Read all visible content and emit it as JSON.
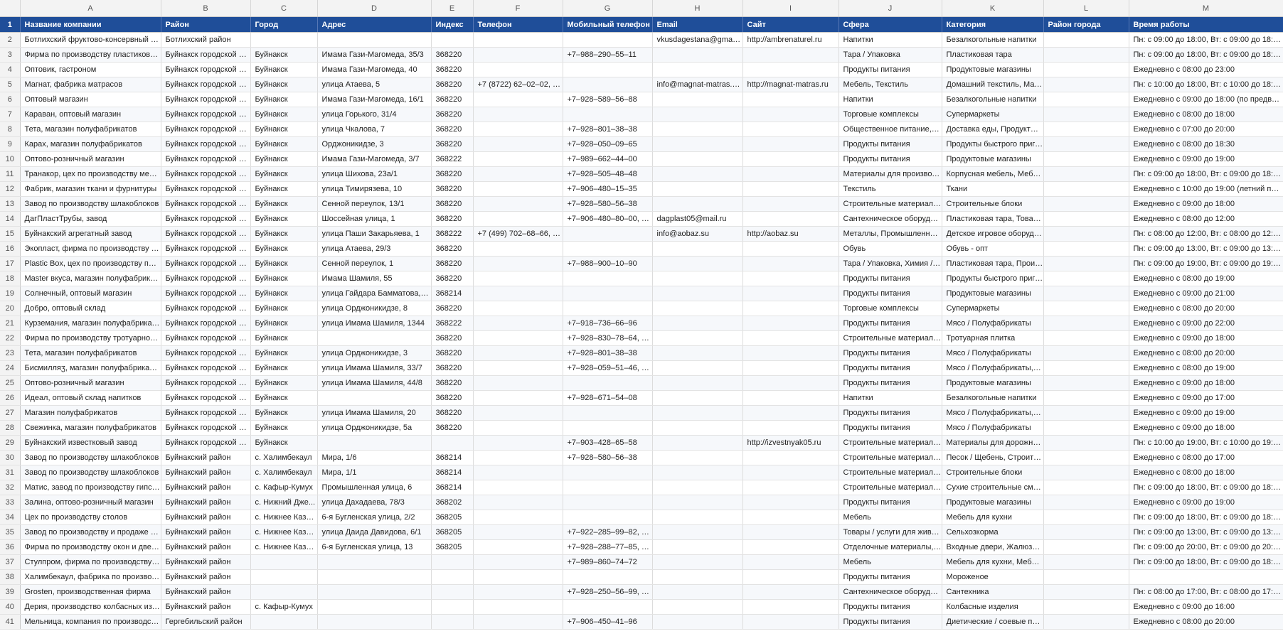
{
  "columns": [
    "A",
    "B",
    "C",
    "D",
    "E",
    "F",
    "G",
    "H",
    "I",
    "J",
    "K",
    "L",
    "M"
  ],
  "header_row_number": "1",
  "headers": [
    "Название компании",
    "Район",
    "Город",
    "Адрес",
    "Индекс",
    "Телефон",
    "Мобильный телефон",
    "Email",
    "Сайт",
    "Сфера",
    "Категория",
    "Район города",
    "Время работы"
  ],
  "rows": [
    {
      "n": "2",
      "cells": [
        "Ботлихский фруктово-консервный за...",
        "Ботлихский район",
        "",
        "",
        "",
        "",
        "",
        "vkusdagestana@gmail.c...",
        "http://ambrenaturel.ru",
        "Напитки",
        "Безалкогольные напитки",
        "",
        "Пн: с 09:00 до 18:00, Вт: с 09:00 до 18:00, С..."
      ]
    },
    {
      "n": "3",
      "cells": [
        "Фирма по производству пластиковых...",
        "Буйнакск городской ок...",
        "Буйнакск",
        "Имама Гази-Магомеда, 35/3",
        "368220",
        "",
        "+7‒988‒290‒55‒11",
        "",
        "",
        "Тара / Упаковка",
        "Пластиковая тара",
        "",
        "Пн: с 09:00 до 18:00, Вт: с 09:00 до 18:00, С..."
      ]
    },
    {
      "n": "4",
      "cells": [
        "Оптовик, гастроном",
        "Буйнакск городской ок...",
        "Буйнакск",
        "Имама Гази-Магомеда, 40",
        "368220",
        "",
        "",
        "",
        "",
        "Продукты питания",
        "Продуктовые магазины",
        "",
        "Ежедневно с 08:00 до 23:00"
      ]
    },
    {
      "n": "5",
      "cells": [
        "Магнат, фабрика матрасов",
        "Буйнакск городской ок...",
        "Буйнакск",
        "улица Атаева, 5",
        "368220",
        "+7 (8722) 62‒02‒02, 8‒...",
        "",
        "info@magnat-matras.ru...",
        "http://magnat-matras.ru",
        "Мебель, Текстиль",
        "Домашний текстиль, Матр...",
        "",
        "Пн: с 10:00 до 18:00, Вт: с 10:00 до 18:00, С..."
      ]
    },
    {
      "n": "6",
      "cells": [
        "Оптовый магазин",
        "Буйнакск городской ок...",
        "Буйнакск",
        "Имама Гази-Магомеда, 16/1",
        "368220",
        "",
        "+7‒928‒589‒56‒88",
        "",
        "",
        "Напитки",
        "Безалкогольные напитки",
        "",
        "Ежедневно с 09:00 до 18:00 (по предвари..."
      ]
    },
    {
      "n": "7",
      "cells": [
        "Караван, оптовый магазин",
        "Буйнакск городской ок...",
        "Буйнакск",
        "улица Горького, 31/4",
        "368220",
        "",
        "",
        "",
        "",
        "Торговые комплексы",
        "Супермаркеты",
        "",
        "Ежедневно с 08:00 до 18:00"
      ]
    },
    {
      "n": "8",
      "cells": [
        "Тета, магазин полуфабрикатов",
        "Буйнакск городской ок...",
        "Буйнакск",
        "улица Чкалова, 7",
        "368220",
        "",
        "+7‒928‒801‒38‒38",
        "",
        "",
        "Общественное питание, П...",
        "Доставка еды, Продукты б...",
        "",
        "Ежедневно с 07:00 до 20:00"
      ]
    },
    {
      "n": "9",
      "cells": [
        "Карах, магазин полуфабрикатов",
        "Буйнакск городской ок...",
        "Буйнакск",
        "Орджоникидзе, 3",
        "368220",
        "",
        "+7‒928‒050‒09‒65",
        "",
        "",
        "Продукты питания",
        "Продукты быстрого приго...",
        "",
        "Ежедневно с 08:00 до 18:30"
      ]
    },
    {
      "n": "10",
      "cells": [
        "Оптово-розничный магазин",
        "Буйнакск городской ок...",
        "Буйнакск",
        "Имама Гази-Магомеда, 3/7",
        "368222",
        "",
        "+7‒989‒662‒44‒00",
        "",
        "",
        "Продукты питания",
        "Продуктовые магазины",
        "",
        "Ежедневно с 09:00 до 19:00"
      ]
    },
    {
      "n": "11",
      "cells": [
        "Транакор, цех по производству мебели",
        "Буйнакск городской ок...",
        "Буйнакск",
        "улица Шихова, 23а/1",
        "368220",
        "",
        "+7‒928‒505‒48‒48",
        "",
        "",
        "Материалы для производс...",
        "Корпусная мебель, Мебел...",
        "",
        "Пн: с 09:00 до 18:00, Вт: с 09:00 до 18:00, С..."
      ]
    },
    {
      "n": "12",
      "cells": [
        "Фабрик, магазин ткани и фурнитуры",
        "Буйнакск городской ок...",
        "Буйнакск",
        "улица Тимирязева, 10",
        "368220",
        "",
        "+7‒906‒480‒15‒35",
        "",
        "",
        "Текстиль",
        "Ткани",
        "",
        "Ежедневно с 10:00 до 19:00 (летний пери..."
      ]
    },
    {
      "n": "13",
      "cells": [
        "Завод по производству шлакоблоков",
        "Буйнакск городской ок...",
        "Буйнакск",
        "Сенной переулок, 13/1",
        "368220",
        "",
        "+7‒928‒580‒56‒38",
        "",
        "",
        "Строительные материалы ...",
        "Строительные блоки",
        "",
        "Ежедневно с 09:00 до 18:00"
      ]
    },
    {
      "n": "14",
      "cells": [
        "ДагПластТрубы, завод",
        "Буйнакск городской ок...",
        "Буйнакск",
        "Шоссейная улица, 1",
        "368220",
        "",
        "+7‒906‒480‒80‒00, +7...",
        "dagplast05@mail.ru",
        "",
        "Сантехническое оборудов...",
        "Пластиковая тара, Товары ...",
        "",
        "Ежедневно с 08:00 до 12:00"
      ]
    },
    {
      "n": "15",
      "cells": [
        "Буйнакский агрегатный завод",
        "Буйнакск городской ок...",
        "Буйнакск",
        "улица Паши Закарьяева, 1",
        "368222",
        "+7 (499) 702‒68‒66, +7...",
        "",
        "info@aobaz.su",
        "http://aobaz.su",
        "Металлы, Промышленное ...",
        "Детское игровое оборудо...",
        "",
        "Пн: с 08:00 до 12:00, Вт: с 08:00 до 12:00, С..."
      ]
    },
    {
      "n": "16",
      "cells": [
        "Экопласт, фирма по производству по...",
        "Буйнакск городской ок...",
        "Буйнакск",
        "улица Атаева, 29/3",
        "368220",
        "",
        "",
        "",
        "",
        "Обувь",
        "Обувь - опт",
        "",
        "Пн: с 09:00 до 13:00, Вт: с 09:00 до 13:00, С..."
      ]
    },
    {
      "n": "17",
      "cells": [
        "Plastic Box, цех по производству плас...",
        "Буйнакск городской ок...",
        "Буйнакск",
        "Сенной переулок, 1",
        "368220",
        "",
        "+7‒988‒900‒10‒90",
        "",
        "",
        "Тара / Упаковка, Химия / В...",
        "Пластиковая тара, Произв...",
        "",
        "Пн: с 09:00 до 19:00, Вт: с 09:00 до 19:00, С..."
      ]
    },
    {
      "n": "18",
      "cells": [
        "Master вкуса, магазин полуфабрикатов",
        "Буйнакск городской ок...",
        "Буйнакск",
        "Имама Шамиля, 55",
        "368220",
        "",
        "",
        "",
        "",
        "Продукты питания",
        "Продукты быстрого приго...",
        "",
        "Ежедневно с 08:00 до 19:00"
      ]
    },
    {
      "n": "19",
      "cells": [
        "Солнечный, оптовый магазин",
        "Буйнакск городской ок...",
        "Буйнакск",
        "улица Гайдара Бамматова, 1/2",
        "368214",
        "",
        "",
        "",
        "",
        "Продукты питания",
        "Продуктовые магазины",
        "",
        "Ежедневно с 09:00 до 21:00"
      ]
    },
    {
      "n": "20",
      "cells": [
        "Добро, оптовый склад",
        "Буйнакск городской ок...",
        "Буйнакск",
        "улица Орджоникидзе, 8",
        "368220",
        "",
        "",
        "",
        "",
        "Торговые комплексы",
        "Супермаркеты",
        "",
        "Ежедневно с 08:00 до 20:00"
      ]
    },
    {
      "n": "21",
      "cells": [
        "Курземания, магазин полуфабрикатов",
        "Буйнакск городской ок...",
        "Буйнакск",
        "улица Имама Шамиля, 1344",
        "368222",
        "",
        "+7‒918‒736‒66‒96",
        "",
        "",
        "Продукты питания",
        "Мясо / Полуфабрикаты",
        "",
        "Ежедневно с 09:00 до 22:00"
      ]
    },
    {
      "n": "22",
      "cells": [
        "Фирма по производству тротуарной ...",
        "Буйнакск городской ок...",
        "Буйнакск",
        "",
        "368220",
        "",
        "+7‒928‒830‒78‒64, +7...",
        "",
        "",
        "Строительные материалы ...",
        "Тротуарная плитка",
        "",
        "Ежедневно с 09:00 до 18:00"
      ]
    },
    {
      "n": "23",
      "cells": [
        "Тета, магазин полуфабрикатов",
        "Буйнакск городской ок...",
        "Буйнакск",
        "улица Орджоникидзе, 3",
        "368220",
        "",
        "+7‒928‒801‒38‒38",
        "",
        "",
        "Продукты питания",
        "Мясо / Полуфабрикаты",
        "",
        "Ежедневно с 08:00 до 20:00"
      ]
    },
    {
      "n": "24",
      "cells": [
        "Бисмилляӡ, магазин полуфабрикатов",
        "Буйнакск городской ок...",
        "Буйнакск",
        "улица Имама Шамиля, 33/7",
        "368220",
        "",
        "+7‒928‒059‒51‒46, +7...",
        "",
        "",
        "Продукты питания",
        "Мясо / Полуфабрикаты, П...",
        "",
        "Ежедневно с 08:00 до 19:00"
      ]
    },
    {
      "n": "25",
      "cells": [
        "Оптово-розничный магазин",
        "Буйнакск городской ок...",
        "Буйнакск",
        "улица Имама Шамиля, 44/8",
        "368220",
        "",
        "",
        "",
        "",
        "Продукты питания",
        "Продуктовые магазины",
        "",
        "Ежедневно с 09:00 до 18:00"
      ]
    },
    {
      "n": "26",
      "cells": [
        "Идеал, оптовый склад напитков",
        "Буйнакск городской ок...",
        "Буйнакск",
        "",
        "368220",
        "",
        "+7‒928‒671‒54‒08",
        "",
        "",
        "Напитки",
        "Безалкогольные напитки",
        "",
        "Ежедневно с 09:00 до 17:00"
      ]
    },
    {
      "n": "27",
      "cells": [
        "Магазин полуфабрикатов",
        "Буйнакск городской ок...",
        "Буйнакск",
        "улица Имама Шамиля, 20",
        "368220",
        "",
        "",
        "",
        "",
        "Продукты питания",
        "Мясо / Полуфабрикаты, М...",
        "",
        "Ежедневно с 09:00 до 19:00"
      ]
    },
    {
      "n": "28",
      "cells": [
        "Свежинка, магазин полуфабрикатов",
        "Буйнакск городской ок...",
        "Буйнакск",
        "улица Орджоникидзе, 5а",
        "368220",
        "",
        "",
        "",
        "",
        "Продукты питания",
        "Мясо / Полуфабрикаты",
        "",
        "Ежедневно с 09:00 до 18:00"
      ]
    },
    {
      "n": "29",
      "cells": [
        "Буйнакский известковый завод",
        "Буйнакск городской ок...",
        "Буйнакск",
        "",
        "",
        "",
        "+7‒903‒428‒65‒58",
        "",
        "http://izvestnyak05.ru",
        "Строительные материалы ...",
        "Материалы для дорожног...",
        "",
        "Пн: с 10:00 до 19:00, Вт: с 10:00 до 19:00, С..."
      ]
    },
    {
      "n": "30",
      "cells": [
        "Завод по производству шлакоблоков",
        "Буйнакский район",
        "с. Халимбекаул",
        "Мира, 1/6",
        "368214",
        "",
        "+7‒928‒580‒56‒38",
        "",
        "",
        "Строительные материалы ...",
        "Песок / Щебень, Строител...",
        "",
        "Ежедневно с 08:00 до 17:00"
      ]
    },
    {
      "n": "31",
      "cells": [
        "Завод по производству шлакоблоков",
        "Буйнакский район",
        "с. Халимбекаул",
        "Мира, 1/1",
        "368214",
        "",
        "",
        "",
        "",
        "Строительные материалы ...",
        "Строительные блоки",
        "",
        "Ежедневно с 08:00 до 18:00"
      ]
    },
    {
      "n": "32",
      "cells": [
        "Матис, завод по производству гипсов...",
        "Буйнакский район",
        "с. Кафыр-Кумух",
        "Промышленная улица, 6",
        "368214",
        "",
        "",
        "",
        "",
        "Строительные материалы ...",
        "Сухие строительные смеси",
        "",
        "Пн: с 09:00 до 18:00, Вт: с 09:00 до 18:00, С..."
      ]
    },
    {
      "n": "33",
      "cells": [
        "Залина, оптово-розничный магазин",
        "Буйнакский район",
        "с. Нижний Дже...",
        "улица Дахадаева, 78/3",
        "368202",
        "",
        "",
        "",
        "",
        "Продукты питания",
        "Продуктовые магазины",
        "",
        "Ежедневно с 09:00 до 19:00"
      ]
    },
    {
      "n": "34",
      "cells": [
        "Цех по производству столов",
        "Буйнакский район",
        "с. Нижнее Каза...",
        "6-я Бугленская улица, 2/2",
        "368205",
        "",
        "",
        "",
        "",
        "Мебель",
        "Мебель для кухни",
        "",
        "Пн: с 09:00 до 18:00, Вт: с 09:00 до 18:00, С..."
      ]
    },
    {
      "n": "35",
      "cells": [
        "Завод по производству и продаже се...",
        "Буйнакский район",
        "с. Нижнее Каза...",
        "улица Даида Давидова, 6/1",
        "368205",
        "",
        "+7‒922‒285‒99‒82, +7...",
        "",
        "",
        "Товары / услуги для живот...",
        "Сельхозкорма",
        "",
        "Пн: с 09:00 до 13:00, Вт: с 09:00 до 13:00, С..."
      ]
    },
    {
      "n": "36",
      "cells": [
        "Фирма по производству окон и дверей",
        "Буйнакский район",
        "с. Нижнее Каза...",
        "6-я Бугленская улица, 13",
        "368205",
        "",
        "+7‒928‒288‒77‒85, +7...",
        "",
        "",
        "Отделочные материалы, П...",
        "Входные двери, Жалюзи, ...",
        "",
        "Пн: с 09:00 до 20:00, Вт: с 09:00 до 20:00, С..."
      ]
    },
    {
      "n": "37",
      "cells": [
        "Стулпром, фирма по производству ст...",
        "Буйнакский район",
        "",
        "",
        "",
        "",
        "+7‒989‒860‒74‒72",
        "",
        "",
        "Мебель",
        "Мебель для кухни, Мебель...",
        "",
        "Пн: с 09:00 до 18:00, Вт: с 09:00 до 18:00, С..."
      ]
    },
    {
      "n": "38",
      "cells": [
        "Халимбекаул, фабрика по производст...",
        "Буйнакский район",
        "",
        "",
        "",
        "",
        "",
        "",
        "",
        "Продукты питания",
        "Мороженое",
        "",
        ""
      ]
    },
    {
      "n": "39",
      "cells": [
        "Grosten, производственная фирма",
        "Буйнакский район",
        "",
        "",
        "",
        "",
        "+7‒928‒250‒56‒99, +7...",
        "",
        "",
        "Сантехническое оборудов...",
        "Сантехника",
        "",
        "Пн: с 08:00 до 17:00, Вт: с 08:00 до 17:00, С..."
      ]
    },
    {
      "n": "40",
      "cells": [
        "Дерия, производство колбасных изде...",
        "Буйнакский район",
        "с. Кафыр-Кумух",
        "",
        "",
        "",
        "",
        "",
        "",
        "Продукты питания",
        "Колбасные изделия",
        "",
        "Ежедневно с 09:00 до 16:00"
      ]
    },
    {
      "n": "41",
      "cells": [
        "Мельница, компания по производств...",
        "Гергебильский район",
        "",
        "",
        "",
        "",
        "+7‒906‒450‒41‒96",
        "",
        "",
        "Продукты питания",
        "Диетические / соевые про...",
        "",
        "Ежедневно с 08:00 до 20:00"
      ]
    }
  ]
}
